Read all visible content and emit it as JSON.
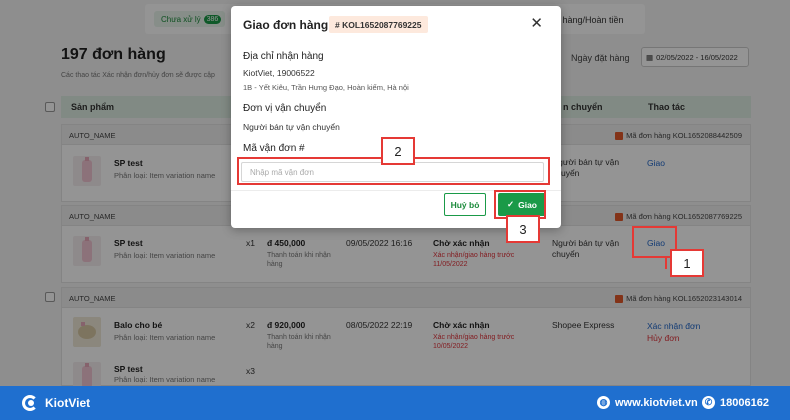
{
  "tabs": {
    "pending_label": "Chưa xử lý",
    "pending_count": "386",
    "right_label": "á hàng/Hoàn tiền"
  },
  "page": {
    "title": "197 đơn hàng",
    "hint": "Các thao tác Xác nhận đơn/hủy đơn sẽ được cập",
    "date_label": "Ngày đặt hàng",
    "date_range": "02/05/2022 - 16/05/2022"
  },
  "table": {
    "col_product": "Sản phẩm",
    "col_shipping": "n chuyển",
    "col_action": "Thao tác"
  },
  "orders": [
    {
      "shop": "AUTO_NAME",
      "code": "Mã đơn hàng KOL1652088442509",
      "product": "SP test",
      "variation": "Phân loại: Item variation name",
      "shipping": "Người bán tự vận chuyển",
      "action": "Giao"
    },
    {
      "shop": "AUTO_NAME",
      "code": "Mã đơn hàng KOL1652087769225",
      "product": "SP test",
      "variation": "Phân loại: Item variation name",
      "qty": "x1",
      "price": "đ 450,000",
      "payment": "Thanh toán khi nhận hàng",
      "date": "09/05/2022 16:16",
      "status": "Chờ xác nhận",
      "deadline": "Xác nhận/giao hàng trước 11/05/2022",
      "shipping": "Người bán tự vận chuyển",
      "action": "Giao"
    },
    {
      "shop": "AUTO_NAME",
      "code": "Mã đơn hàng KOL1652023143014",
      "product": "Balo cho bé",
      "variation": "Phân loại: Item variation name",
      "qty": "x2",
      "price": "đ 920,000",
      "payment": "Thanh toán khi nhận hàng",
      "date": "08/05/2022 22:19",
      "status": "Chờ xác nhận",
      "deadline": "Xác nhận/giao hàng trước 10/05/2022",
      "shipping": "Shopee Express",
      "action": "Xác nhận đơn",
      "action2": "Hủy đơn",
      "product2": "SP test",
      "variation2": "Phân loại: Item variation name",
      "qty2": "x3"
    }
  ],
  "modal": {
    "title": "Giao đơn hàng",
    "order_code": "# KOL1652087769225",
    "address_label": "Địa chỉ nhận hàng",
    "recipient": "KiotViet, 19006522",
    "address": "1B - Yết Kiêu, Trần Hưng Đạo, Hoàn kiếm, Hà nội",
    "carrier_label": "Đơn vị vận chuyển",
    "carrier": "Người bán tự vận chuyển",
    "tracking_label": "Mã vận đơn #",
    "tracking_placeholder": "Nhập mã vận đơn",
    "tracking_value": "",
    "cancel_label": "Huỷ bỏ",
    "submit_label": "Giao"
  },
  "annotations": {
    "step1": "1",
    "step2": "2",
    "step3": "3",
    "color": "#e53935"
  },
  "footer": {
    "brand": "KiotViet",
    "website": "www.kiotviet.vn",
    "phone": "18006162",
    "bg_color": "#1f6fcf"
  }
}
